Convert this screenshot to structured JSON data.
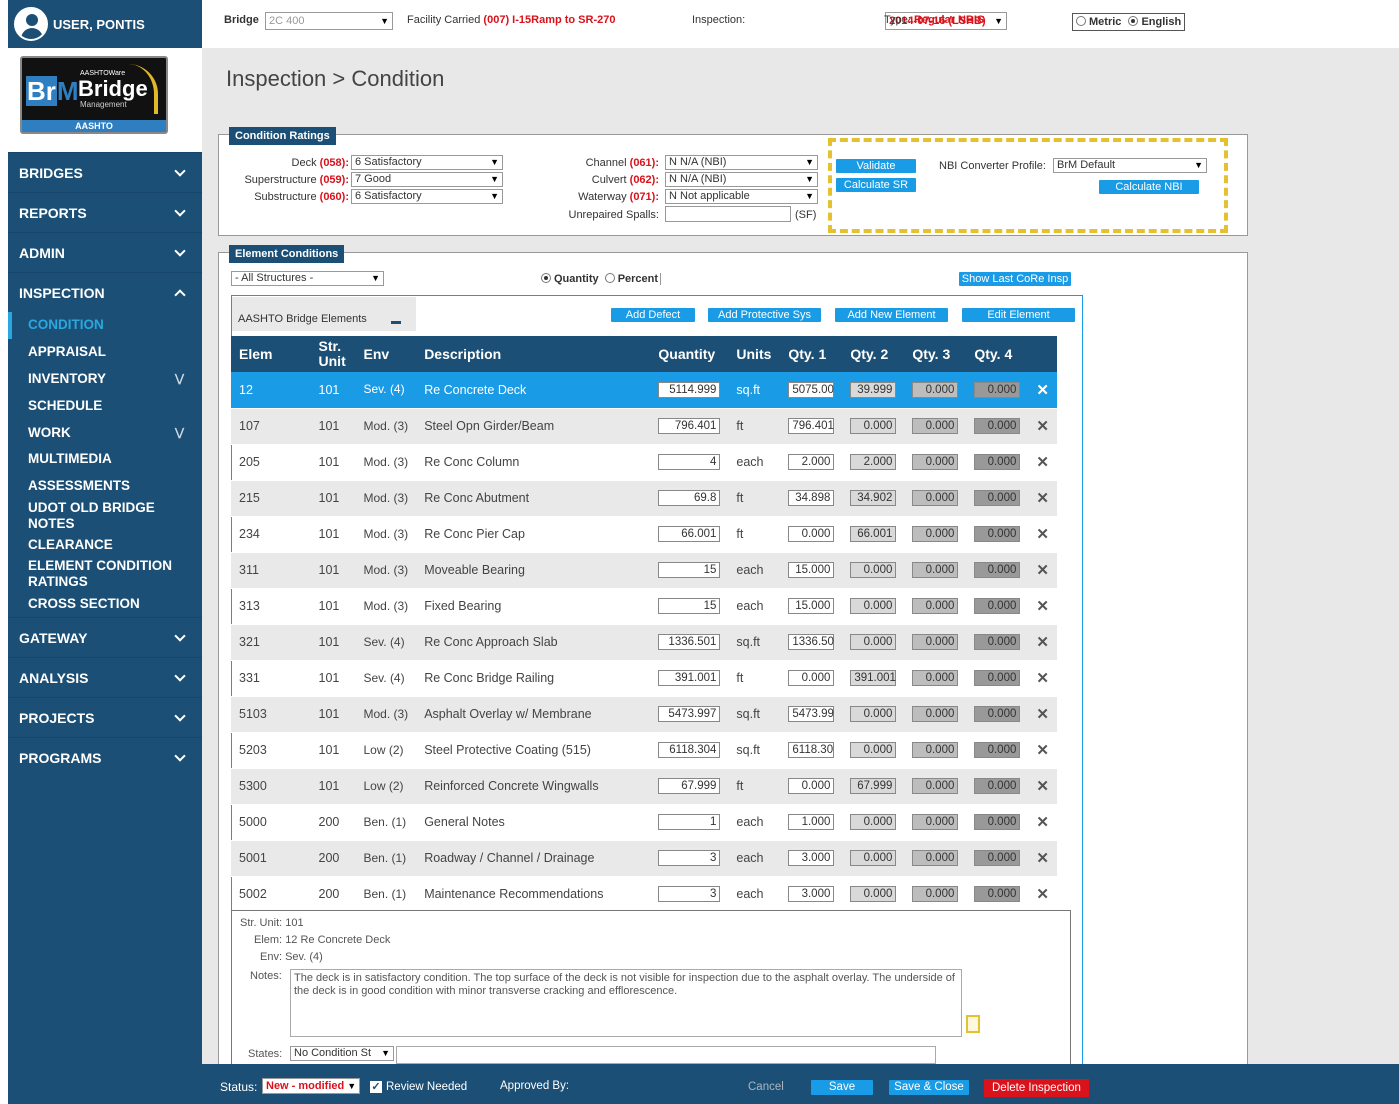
{
  "user": {
    "name": "USER, PONTIS"
  },
  "logo": {
    "aashtoware": "AASHTOWare",
    "brm": "BrM",
    "bridge": "Bridge",
    "management": "Management",
    "aashto": "AASHTO"
  },
  "nav": {
    "main1": [
      {
        "label": "BRIDGES"
      },
      {
        "label": "REPORTS"
      },
      {
        "label": "ADMIN"
      },
      {
        "label": "INSPECTION"
      }
    ],
    "sub": [
      {
        "label": "CONDITION"
      },
      {
        "label": "APPRAISAL"
      },
      {
        "label": "INVENTORY"
      },
      {
        "label": "SCHEDULE"
      },
      {
        "label": "WORK"
      },
      {
        "label": "MULTIMEDIA"
      },
      {
        "label": "ASSESSMENTS"
      },
      {
        "label": "UDOT OLD BRIDGE NOTES"
      },
      {
        "label": "CLEARANCE"
      },
      {
        "label": "ELEMENT CONDITION RATINGS"
      },
      {
        "label": "CROSS SECTION"
      }
    ],
    "main2": [
      {
        "label": "GATEWAY"
      },
      {
        "label": "ANALYSIS"
      },
      {
        "label": "PROJECTS"
      },
      {
        "label": "PROGRAMS"
      }
    ]
  },
  "topbar": {
    "bridge_label": "Bridge",
    "bridge_value": "2C 400",
    "facility_label": "Facility Carried",
    "facility_code": "(007)",
    "facility_value": "I-15Ramp to SR-270",
    "inspection_label": "Inspection:",
    "inspection_value": "2014-07-16 (LSHB)",
    "type_label": "Type:",
    "type_value": "Regular NBIS",
    "metric": "Metric",
    "english": "English"
  },
  "page": {
    "title": "Inspection > Condition"
  },
  "ratings": {
    "title": "Condition Ratings",
    "deck": {
      "label": "Deck",
      "code": "(058):",
      "value": "6 Satisfactory"
    },
    "super": {
      "label": "Superstructure",
      "code": "(059):",
      "value": "7 Good"
    },
    "sub": {
      "label": "Substructure",
      "code": "(060):",
      "value": "6 Satisfactory"
    },
    "channel": {
      "label": "Channel",
      "code": "(061):",
      "value": "N N/A (NBI)"
    },
    "culvert": {
      "label": "Culvert",
      "code": "(062):",
      "value": "N N/A (NBI)"
    },
    "waterway": {
      "label": "Waterway",
      "code": "(071):",
      "value": "N Not applicable"
    },
    "spalls": {
      "label": "Unrepaired Spalls:",
      "value": "",
      "unit": "(SF)"
    },
    "validate": "Validate",
    "calc_sr": "Calculate SR",
    "profile_label": "NBI Converter Profile:",
    "profile_value": "BrM Default",
    "calc_nbi": "Calculate NBI"
  },
  "elements": {
    "title": "Element Conditions",
    "filter": "- All Structures -",
    "quantity": "Quantity",
    "percent": "Percent",
    "show_last": "Show Last CoRe Insp",
    "group": "AASHTO Bridge Elements",
    "add_defect": "Add Defect",
    "add_prot": "Add Protective Sys",
    "add_new": "Add New Element",
    "edit": "Edit Element",
    "headers": [
      "Elem",
      "Str. Unit",
      "Env",
      "Description",
      "Quantity",
      "Units",
      "Qty. 1",
      "Qty. 2",
      "Qty. 3",
      "Qty. 4"
    ],
    "rows": [
      {
        "elem": "12",
        "unit": "101",
        "env": "Sev. (4)",
        "desc": "Re Concrete Deck",
        "qty": "5114.999",
        "units": "sq.ft",
        "q1": "5075.00",
        "q2": "39.999",
        "q3": "0.000",
        "q4": "0.000"
      },
      {
        "elem": "107",
        "unit": "101",
        "env": "Mod. (3)",
        "desc": "Steel Opn Girder/Beam",
        "qty": "796.401",
        "units": "ft",
        "q1": "796.401",
        "q2": "0.000",
        "q3": "0.000",
        "q4": "0.000"
      },
      {
        "elem": "205",
        "unit": "101",
        "env": "Mod. (3)",
        "desc": "Re Conc Column",
        "qty": "4",
        "units": "each",
        "q1": "2.000",
        "q2": "2.000",
        "q3": "0.000",
        "q4": "0.000"
      },
      {
        "elem": "215",
        "unit": "101",
        "env": "Mod. (3)",
        "desc": "Re Conc Abutment",
        "qty": "69.8",
        "units": "ft",
        "q1": "34.898",
        "q2": "34.902",
        "q3": "0.000",
        "q4": "0.000"
      },
      {
        "elem": "234",
        "unit": "101",
        "env": "Mod. (3)",
        "desc": "Re Conc Pier Cap",
        "qty": "66.001",
        "units": "ft",
        "q1": "0.000",
        "q2": "66.001",
        "q3": "0.000",
        "q4": "0.000"
      },
      {
        "elem": "311",
        "unit": "101",
        "env": "Mod. (3)",
        "desc": "Moveable Bearing",
        "qty": "15",
        "units": "each",
        "q1": "15.000",
        "q2": "0.000",
        "q3": "0.000",
        "q4": "0.000"
      },
      {
        "elem": "313",
        "unit": "101",
        "env": "Mod. (3)",
        "desc": "Fixed Bearing",
        "qty": "15",
        "units": "each",
        "q1": "15.000",
        "q2": "0.000",
        "q3": "0.000",
        "q4": "0.000"
      },
      {
        "elem": "321",
        "unit": "101",
        "env": "Sev. (4)",
        "desc": "Re Conc Approach Slab",
        "qty": "1336.501",
        "units": "sq.ft",
        "q1": "1336.50",
        "q2": "0.000",
        "q3": "0.000",
        "q4": "0.000"
      },
      {
        "elem": "331",
        "unit": "101",
        "env": "Sev. (4)",
        "desc": "Re Conc Bridge Railing",
        "qty": "391.001",
        "units": "ft",
        "q1": "0.000",
        "q2": "391.001",
        "q3": "0.000",
        "q4": "0.000"
      },
      {
        "elem": "5103",
        "unit": "101",
        "env": "Mod. (3)",
        "desc": "Asphalt Overlay w/ Membrane",
        "qty": "5473.997",
        "units": "sq.ft",
        "q1": "5473.99",
        "q2": "0.000",
        "q3": "0.000",
        "q4": "0.000"
      },
      {
        "elem": "5203",
        "unit": "101",
        "env": "Low (2)",
        "desc": "Steel Protective Coating (515)",
        "qty": "6118.304",
        "units": "sq.ft",
        "q1": "6118.30",
        "q2": "0.000",
        "q3": "0.000",
        "q4": "0.000"
      },
      {
        "elem": "5300",
        "unit": "101",
        "env": "Low (2)",
        "desc": "Reinforced Concrete Wingwalls",
        "qty": "67.999",
        "units": "ft",
        "q1": "0.000",
        "q2": "67.999",
        "q3": "0.000",
        "q4": "0.000"
      },
      {
        "elem": "5000",
        "unit": "200",
        "env": "Ben. (1)",
        "desc": "General Notes",
        "qty": "1",
        "units": "each",
        "q1": "1.000",
        "q2": "0.000",
        "q3": "0.000",
        "q4": "0.000"
      },
      {
        "elem": "5001",
        "unit": "200",
        "env": "Ben. (1)",
        "desc": "Roadway / Channel / Drainage",
        "qty": "3",
        "units": "each",
        "q1": "3.000",
        "q2": "0.000",
        "q3": "0.000",
        "q4": "0.000"
      },
      {
        "elem": "5002",
        "unit": "200",
        "env": "Ben. (1)",
        "desc": "Maintenance Recommendations",
        "qty": "3",
        "units": "each",
        "q1": "3.000",
        "q2": "0.000",
        "q3": "0.000",
        "q4": "0.000"
      }
    ]
  },
  "detail": {
    "str_unit_label": "Str. Unit:",
    "str_unit": "101",
    "elem_label": "Elem:",
    "elem": "12 Re Concrete Deck",
    "env_label": "Env:",
    "env": "Sev. (4)",
    "notes_label": "Notes:",
    "notes": "The deck is in satisfactory condition. The top surface of the deck is not visible for inspection due to the asphalt overlay. The underside of the deck is in good condition with minor transverse cracking and efflorescence.",
    "states_label": "States:",
    "states_value": "No Condition St"
  },
  "status": {
    "label": "Status:",
    "value": "New - modified",
    "review": "Review Needed",
    "approved": "Approved By:",
    "cancel": "Cancel",
    "save": "Save",
    "save_close": "Save & Close",
    "delete": "Delete Inspection"
  }
}
